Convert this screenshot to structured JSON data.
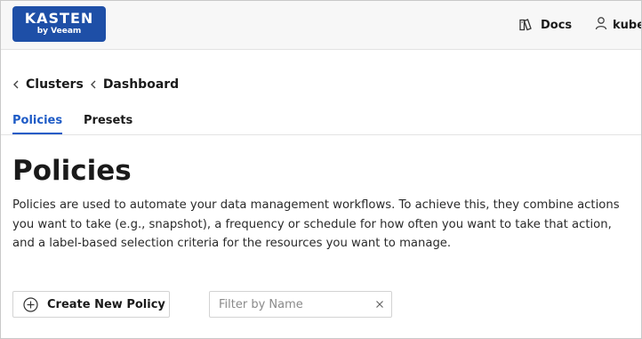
{
  "header": {
    "logo": {
      "brand": "KASTEN",
      "tagline": "by Veeam"
    },
    "docs_label": "Docs",
    "user_label": "kube:",
    "colors": {
      "logo_bg": "#1e4fa7",
      "topbar_bg": "#f7f7f7"
    },
    "icons": {
      "docs": "book-icon",
      "user": "user-icon"
    }
  },
  "breadcrumb": {
    "items": [
      "Clusters",
      "Dashboard"
    ],
    "icon": "chevron-left-icon"
  },
  "tabs": [
    {
      "label": "Policies",
      "active": true
    },
    {
      "label": "Presets",
      "active": false
    }
  ],
  "main": {
    "title": "Policies",
    "description": "Policies are used to automate your data management workflows. To achieve this, they combine actions you want to take (e.g., snapshot), a frequency or schedule for how often you want to take that action, and a label-based selection criteria for the resources you want to manage.",
    "create_button_label": "Create New Policy",
    "create_button_icon": "plus-circle-icon",
    "filter": {
      "placeholder": "Filter by Name",
      "value": "",
      "clear_icon": "close-icon"
    },
    "accent_color": "#1e5bc6"
  }
}
